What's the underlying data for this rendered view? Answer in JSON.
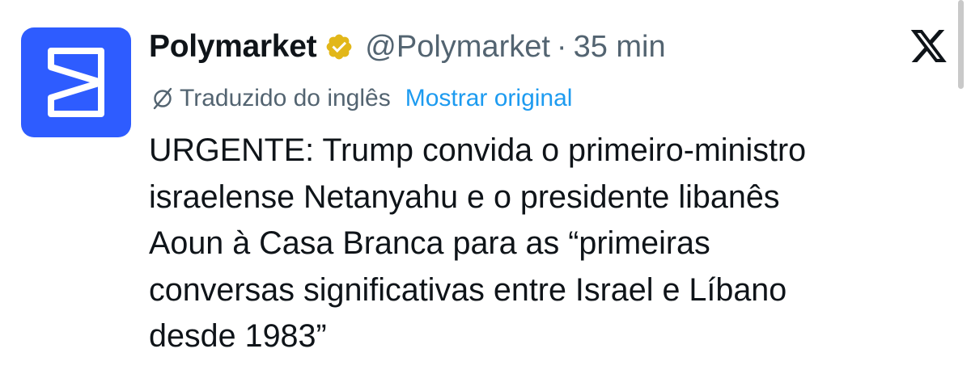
{
  "author": {
    "display_name": "Polymarket",
    "handle": "@Polymarket",
    "separator": "·",
    "time": "35 min",
    "verified_badge_color": "#e2b719",
    "avatar_color": "#2e5cff",
    "avatar_icon": "polymarket-logo"
  },
  "platform": {
    "logo": "x-logo"
  },
  "translation": {
    "icon": "translate-icon",
    "label": "Traduzido do inglês",
    "show_original": "Mostrar original"
  },
  "tweet": {
    "text": "URGENTE: Trump convida o primeiro-ministro\nisraelense Netanyahu e o presidente libanês\nAoun à Casa Branca para as “primeiras\nconversas significativas entre Israel e Líbano\ndesde 1983”"
  },
  "colors": {
    "text_primary": "#0f1419",
    "text_secondary": "#536471",
    "link": "#1d9bf0"
  }
}
